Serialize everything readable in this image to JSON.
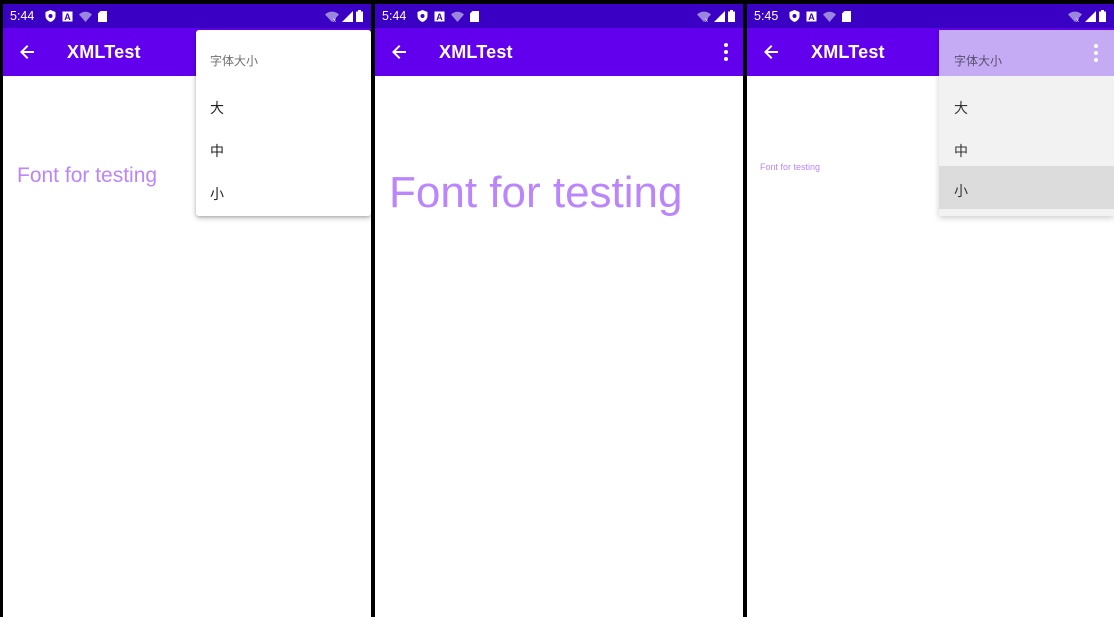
{
  "app": {
    "title": "XMLTest"
  },
  "icons": {
    "back": "arrow-left-icon",
    "overflow": "more-vert-icon"
  },
  "colors": {
    "status_bar": "#3a00c4",
    "app_bar": "#6200ee",
    "sample_text": "#bb86fc",
    "menu_head_dim": "#c4abf3"
  },
  "menu": {
    "title": "字体大小",
    "items": [
      {
        "label": "大"
      },
      {
        "label": "中"
      },
      {
        "label": "小"
      }
    ]
  },
  "sample_text": "Font for testing",
  "screens": [
    {
      "time": "5:44",
      "font_size": "medium",
      "menu_open": true
    },
    {
      "time": "5:44",
      "font_size": "large",
      "menu_open": false
    },
    {
      "time": "5:45",
      "font_size": "small",
      "menu_open": true,
      "highlighted_item": "小"
    }
  ]
}
